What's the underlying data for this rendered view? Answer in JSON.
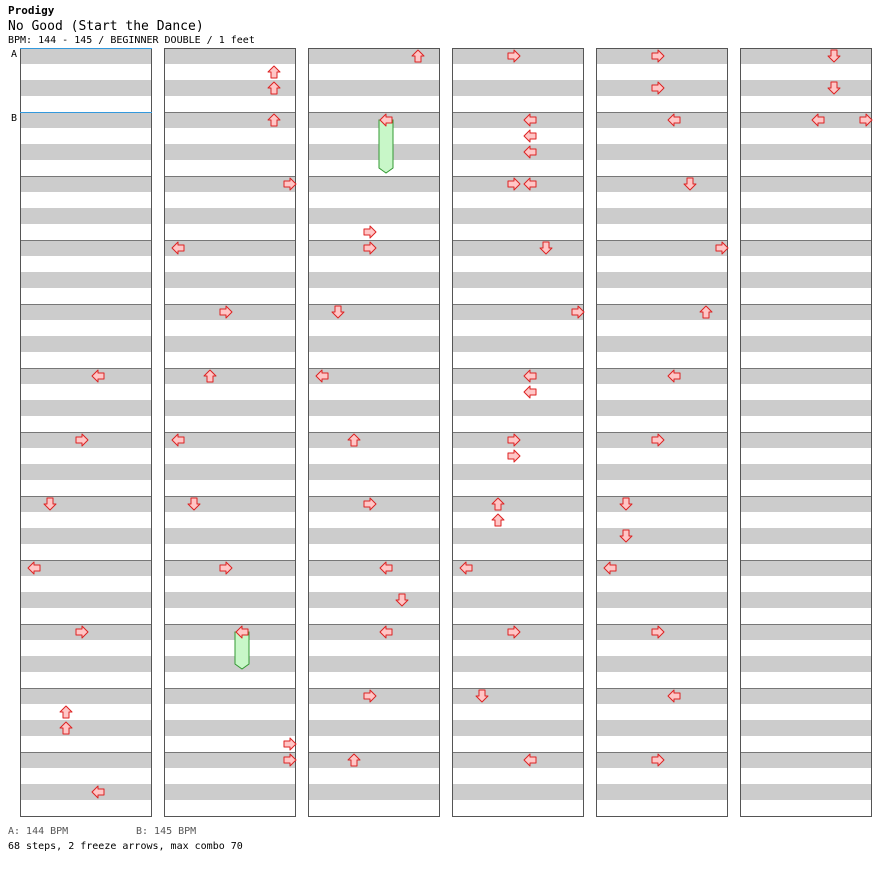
{
  "header": {
    "artist": "Prodigy",
    "title": "No Good (Start the Dance)",
    "meta": "BPM: 144 - 145 / BEGINNER DOUBLE / 1 feet"
  },
  "markers": [
    {
      "label": "A",
      "column": 0,
      "measure": 0
    },
    {
      "label": "B",
      "column": 0,
      "measure": 1
    }
  ],
  "footer": {
    "bpm_a": "A: 144 BPM",
    "bpm_b": "B: 145 BPM",
    "summary": "68 steps, 2 freeze arrows, max combo 70"
  },
  "colors": {
    "stripe": "#cccccc",
    "arrow_fill": "#ffc6c6",
    "arrow_stroke": "#dd2222",
    "freeze_fill": "#c8f7c8",
    "freeze_stroke": "#339933",
    "marker_line": "#3399dd",
    "border": "#555555"
  },
  "chart_data": {
    "type": "step-chart",
    "columns": 6,
    "measures_per_column": 12,
    "lanes": [
      "L1",
      "D1",
      "U1",
      "R1",
      "L2",
      "D2",
      "U2",
      "R2"
    ],
    "notes": [
      {
        "c": 1,
        "m": 0,
        "b": 1,
        "lane": "U2"
      },
      {
        "c": 1,
        "m": 0,
        "b": 2,
        "lane": "U2"
      },
      {
        "c": 1,
        "m": 1,
        "b": 0,
        "lane": "U2"
      },
      {
        "c": 1,
        "m": 2,
        "b": 0,
        "lane": "R2"
      },
      {
        "c": 1,
        "m": 3,
        "b": 0,
        "lane": "L1"
      },
      {
        "c": 1,
        "m": 4,
        "b": 0,
        "lane": "R1"
      },
      {
        "c": 1,
        "m": 5,
        "b": 0,
        "lane": "U1"
      },
      {
        "c": 1,
        "m": 6,
        "b": 0,
        "lane": "L1"
      },
      {
        "c": 1,
        "m": 7,
        "b": 0,
        "lane": "D1"
      },
      {
        "c": 1,
        "m": 8,
        "b": 0,
        "lane": "R1"
      },
      {
        "c": 1,
        "m": 9,
        "b": 0,
        "lane": "L2",
        "freeze": 2
      },
      {
        "c": 1,
        "m": 10,
        "b": 3,
        "lane": "R2"
      },
      {
        "c": 1,
        "m": 11,
        "b": 0,
        "lane": "R2"
      },
      {
        "c": 2,
        "m": 0,
        "b": 0,
        "lane": "U2"
      },
      {
        "c": 2,
        "m": 1,
        "b": 0,
        "lane": "L2",
        "freeze": 3
      },
      {
        "c": 2,
        "m": 3,
        "b": 0,
        "lane": "R1"
      },
      {
        "c": 2,
        "m": 2,
        "b": 3,
        "lane": "R1"
      },
      {
        "c": 2,
        "m": 4,
        "b": 0,
        "lane": "D1"
      },
      {
        "c": 2,
        "m": 5,
        "b": 0,
        "lane": "L1"
      },
      {
        "c": 2,
        "m": 6,
        "b": 0,
        "lane": "U1"
      },
      {
        "c": 2,
        "m": 7,
        "b": 0,
        "lane": "R1"
      },
      {
        "c": 2,
        "m": 8,
        "b": 0,
        "lane": "L2"
      },
      {
        "c": 2,
        "m": 8,
        "b": 2,
        "lane": "D2"
      },
      {
        "c": 2,
        "m": 9,
        "b": 0,
        "lane": "L2"
      },
      {
        "c": 2,
        "m": 10,
        "b": 0,
        "lane": "R1"
      },
      {
        "c": 2,
        "m": 11,
        "b": 0,
        "lane": "U1"
      },
      {
        "c": 3,
        "m": 0,
        "b": 0,
        "lane": "R1"
      },
      {
        "c": 3,
        "m": 1,
        "b": 0,
        "lane": "L2"
      },
      {
        "c": 3,
        "m": 1,
        "b": 1,
        "lane": "L2"
      },
      {
        "c": 3,
        "m": 1,
        "b": 2,
        "lane": "L2"
      },
      {
        "c": 3,
        "m": 2,
        "b": 0,
        "lane": "R1"
      },
      {
        "c": 3,
        "m": 2,
        "b": 0,
        "lane": "L2"
      },
      {
        "c": 3,
        "m": 3,
        "b": 0,
        "lane": "D2"
      },
      {
        "c": 3,
        "m": 4,
        "b": 0,
        "lane": "R2"
      },
      {
        "c": 3,
        "m": 5,
        "b": 0,
        "lane": "L2"
      },
      {
        "c": 3,
        "m": 5,
        "b": 1,
        "lane": "L2"
      },
      {
        "c": 3,
        "m": 6,
        "b": 0,
        "lane": "R1"
      },
      {
        "c": 3,
        "m": 6,
        "b": 1,
        "lane": "R1"
      },
      {
        "c": 3,
        "m": 7,
        "b": 0,
        "lane": "U1"
      },
      {
        "c": 3,
        "m": 7,
        "b": 1,
        "lane": "U1"
      },
      {
        "c": 3,
        "m": 8,
        "b": 0,
        "lane": "L1"
      },
      {
        "c": 3,
        "m": 9,
        "b": 0,
        "lane": "R1"
      },
      {
        "c": 3,
        "m": 10,
        "b": 0,
        "lane": "D1"
      },
      {
        "c": 3,
        "m": 11,
        "b": 0,
        "lane": "L2"
      },
      {
        "c": 4,
        "m": 0,
        "b": 0,
        "lane": "R1"
      },
      {
        "c": 4,
        "m": 0,
        "b": 2,
        "lane": "R1"
      },
      {
        "c": 4,
        "m": 1,
        "b": 0,
        "lane": "L2"
      },
      {
        "c": 4,
        "m": 2,
        "b": 0,
        "lane": "D2"
      },
      {
        "c": 4,
        "m": 3,
        "b": 0,
        "lane": "R2"
      },
      {
        "c": 4,
        "m": 4,
        "b": 0,
        "lane": "U2"
      },
      {
        "c": 4,
        "m": 5,
        "b": 0,
        "lane": "L2"
      },
      {
        "c": 4,
        "m": 6,
        "b": 0,
        "lane": "R1"
      },
      {
        "c": 4,
        "m": 7,
        "b": 0,
        "lane": "D1"
      },
      {
        "c": 4,
        "m": 7,
        "b": 2,
        "lane": "D1"
      },
      {
        "c": 4,
        "m": 8,
        "b": 0,
        "lane": "L1"
      },
      {
        "c": 4,
        "m": 9,
        "b": 0,
        "lane": "R1"
      },
      {
        "c": 4,
        "m": 10,
        "b": 0,
        "lane": "L2"
      },
      {
        "c": 4,
        "m": 11,
        "b": 0,
        "lane": "R1"
      },
      {
        "c": 5,
        "m": 0,
        "b": 0,
        "lane": "D2"
      },
      {
        "c": 5,
        "m": 0,
        "b": 2,
        "lane": "D2"
      },
      {
        "c": 5,
        "m": 1,
        "b": 0,
        "lane": "L2"
      },
      {
        "c": 5,
        "m": 1,
        "b": 0,
        "lane": "R2"
      },
      {
        "c": 0,
        "m": 5,
        "b": 0,
        "lane": "L2"
      },
      {
        "c": 0,
        "m": 6,
        "b": 0,
        "lane": "R1"
      },
      {
        "c": 0,
        "m": 7,
        "b": 0,
        "lane": "D1"
      },
      {
        "c": 0,
        "m": 8,
        "b": 0,
        "lane": "L1"
      },
      {
        "c": 0,
        "m": 9,
        "b": 0,
        "lane": "R1"
      },
      {
        "c": 0,
        "m": 10,
        "b": 1,
        "lane": "U1"
      },
      {
        "c": 0,
        "m": 10,
        "b": 2,
        "lane": "U1"
      },
      {
        "c": 0,
        "m": 11,
        "b": 2,
        "lane": "L2"
      }
    ]
  }
}
